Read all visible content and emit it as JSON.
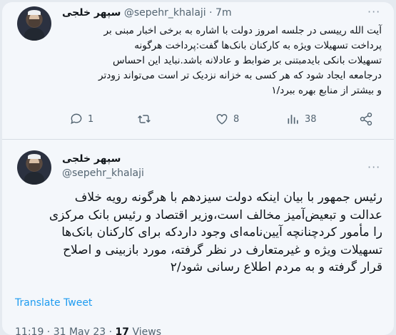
{
  "tweet1": {
    "name": "سپهر خلجی",
    "handle": "@sepehr_khalaji",
    "separator": "·",
    "time": "7m",
    "lines": [
      "آیت الله رییسی در جلسه امروز دولت با اشاره به برخی اخبار مبنی بر",
      "پرداخت تسهیلات ویژه به کارکنان بانک‌ها گفت:پرداخت هرگونه",
      "تسهیلات بانکی بایدمبتنی بر ضوابط و عادلانه باشد.نباید این احساس",
      "درجامعه ایجاد شود که هر کسی به خزانه نزدیک تر است می‌تواند زودتر",
      "و بیشتر از منابع بهره ببرد/۱"
    ],
    "actions": {
      "reply_count": "1",
      "retweet_count": "",
      "like_count": "8",
      "views_count": "38"
    }
  },
  "tweet2": {
    "name": "سپهر خلجی",
    "handle": "@sepehr_khalaji",
    "lines": [
      "رئیس جمهور با بیان اینکه دولت سیزدهم با هرگونه رویه خلاف",
      "عدالت و تبعیض‌آمیز مخالف است،وزیر اقتصاد و رئیس بانک مرکزی",
      "را مأمور کردچنانچه آیین‌نامه‌ای وجود داردکه برای کارکنان بانک‌ها",
      "تسهیلات ویژه و غیرمتعارف در نظر گرفته، مورد بازبینی و اصلاح",
      "قرار گرفته و به مردم اطلاع رسانی شود/۲"
    ],
    "translate_label": "Translate Tweet",
    "timestamp": "11:19 · 31 May 23 · ",
    "views_count": "17",
    "views_label": " Views"
  },
  "colors": {
    "text": "#0f1419",
    "secondary": "#536471",
    "link": "#1d9bf0",
    "background": "#f4f7fb"
  },
  "icons": [
    "more-icon",
    "reply-icon",
    "retweet-icon",
    "like-icon",
    "views-icon",
    "share-icon"
  ]
}
